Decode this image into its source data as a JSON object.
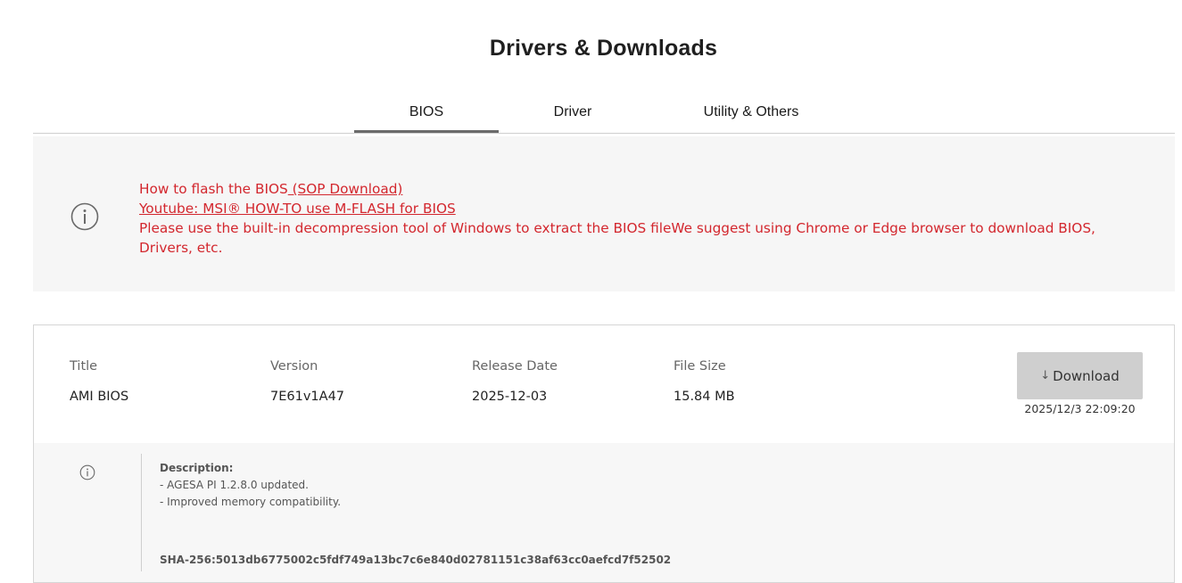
{
  "page": {
    "title": "Drivers & Downloads"
  },
  "tabs": [
    {
      "label": "BIOS",
      "active": true
    },
    {
      "label": "Driver",
      "active": false
    },
    {
      "label": "Utility & Others",
      "active": false
    }
  ],
  "notice": {
    "line1_text": "How to flash the BIOS",
    "line1_link": " (SOP Download)",
    "line2_link": "Youtube: MSI® HOW-TO use M-FLASH for BIOS",
    "line3_text": "Please use the built-in decompression tool of Windows to extract the BIOS fileWe suggest using Chrome or Edge browser to download BIOS, Drivers, etc.",
    "icon": "info-circle-icon",
    "color": "#d3272e"
  },
  "bios_item": {
    "headers": {
      "title": "Title",
      "version": "Version",
      "release_date": "Release Date",
      "file_size": "File Size"
    },
    "title": "AMI BIOS",
    "version": "7E61v1A47",
    "release_date": "2025-12-03",
    "file_size": "15.84 MB",
    "download_label": "Download",
    "download_icon": "arrow-down-icon",
    "download_timestamp": "2025/12/3 22:09:20",
    "description_label": "Description:",
    "description_lines": [
      "- AGESA PI 1.2.8.0 updated.",
      "- Improved memory compatibility."
    ],
    "sha": "SHA-256:5013db6775002c5fdf749a13bc7c6e840d02781151c38af63cc0aefcd7f52502"
  }
}
